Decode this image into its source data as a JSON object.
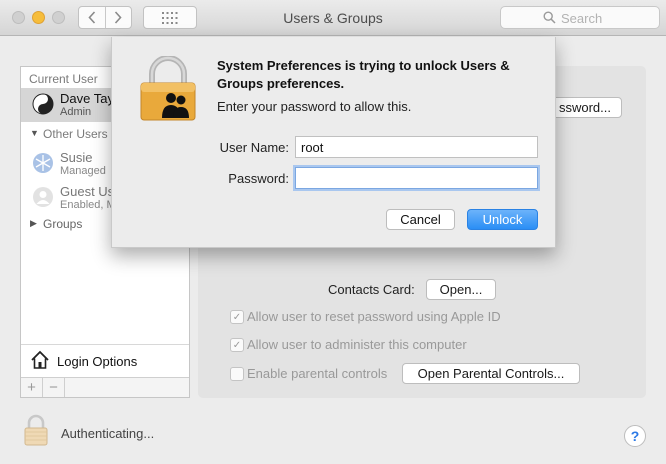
{
  "window": {
    "title": "Users & Groups"
  },
  "search": {
    "placeholder": "Search"
  },
  "sidebar": {
    "current_user_header": "Current User",
    "current_user": {
      "name": "Dave Tay",
      "role": "Admin"
    },
    "other_users_header": "Other Users",
    "other_users": [
      {
        "name": "Susie",
        "status": "Managed"
      },
      {
        "name": "Guest Us",
        "status": "Enabled, M"
      }
    ],
    "groups_label": "Groups",
    "login_options_label": "Login Options",
    "add_label": "+",
    "remove_label": "−"
  },
  "panel": {
    "change_password_button": "ssword...",
    "contacts_card_label": "Contacts Card:",
    "open_button": "Open...",
    "checkboxes": [
      {
        "label": "Allow user to reset password using Apple ID",
        "checked": true
      },
      {
        "label": "Allow user to administer this computer",
        "checked": true
      },
      {
        "label": "Enable parental controls",
        "checked": false
      }
    ],
    "parental_controls_button": "Open Parental Controls..."
  },
  "footer": {
    "auth_text": "Authenticating...",
    "help_label": "?"
  },
  "dialog": {
    "title": "System Preferences is trying to unlock Users & Groups preferences.",
    "message": "Enter your password to allow this.",
    "username_label": "User Name:",
    "username_value": "root",
    "password_label": "Password:",
    "password_value": "",
    "cancel_label": "Cancel",
    "unlock_label": "Unlock"
  },
  "colors": {
    "accent_blue": "#2a8ef5",
    "traffic_yellow": "#f6bd3b",
    "lock_gold": "#e9a93b"
  }
}
